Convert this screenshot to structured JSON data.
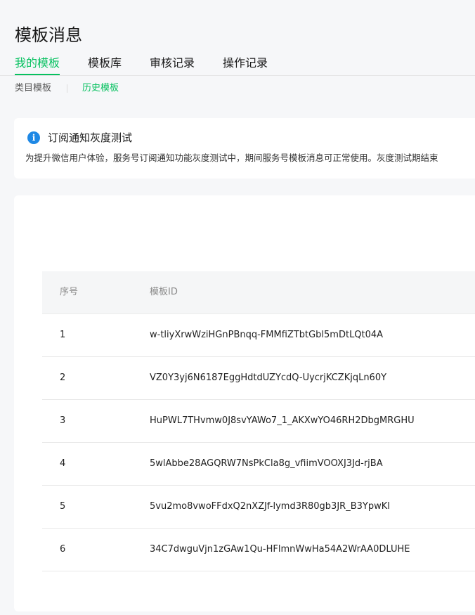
{
  "page": {
    "title": "模板消息"
  },
  "main_tabs": [
    {
      "label": "我的模板",
      "active": true
    },
    {
      "label": "模板库",
      "active": false
    },
    {
      "label": "审核记录",
      "active": false
    },
    {
      "label": "操作记录",
      "active": false
    }
  ],
  "sub_tabs": [
    {
      "label": "类目模板",
      "active": false
    },
    {
      "label": "历史模板",
      "active": true
    }
  ],
  "notice": {
    "icon": "info-icon",
    "title": "订阅通知灰度测试",
    "text": "为提升微信用户体验，服务号订阅通知功能灰度测试中，期间服务号模板消息可正常使用。灰度测试期结束"
  },
  "table": {
    "headers": {
      "seq": "序号",
      "template_id": "模板ID"
    },
    "rows": [
      {
        "seq": "1",
        "template_id": "w-tliyXrwWziHGnPBnqq-FMMfiZTbtGbl5mDtLQt04A"
      },
      {
        "seq": "2",
        "template_id": "VZ0Y3yj6N6187EggHdtdUZYcdQ-UycrjKCZKjqLn60Y"
      },
      {
        "seq": "3",
        "template_id": "HuPWL7THvmw0J8svYAWo7_1_AKXwYO46RH2DbgMRGHU"
      },
      {
        "seq": "4",
        "template_id": "5wlAbbe28AGQRW7NsPkCla8g_vfiimVOOXJ3Jd-rjBA"
      },
      {
        "seq": "5",
        "template_id": "5vu2mo8vwoFFdxQ2nXZJf-lymd3R80gb3JR_B3YpwKl"
      },
      {
        "seq": "6",
        "template_id": "34C7dwguVjn1zGAw1Qu-HFlmnWwHa54A2WrAA0DLUHE"
      }
    ]
  },
  "colors": {
    "accent": "#07c160",
    "info": "#1e88e5",
    "background": "#f6f7f9"
  }
}
